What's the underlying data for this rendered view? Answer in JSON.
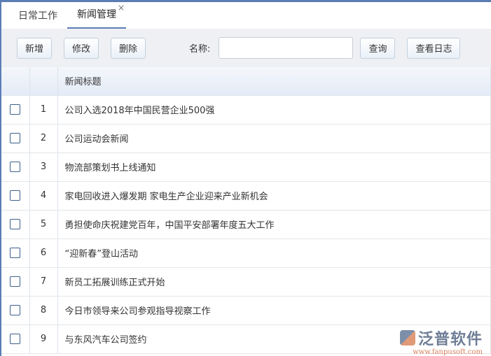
{
  "tabs": [
    {
      "label": "日常工作"
    },
    {
      "label": "新闻管理",
      "close": "×"
    }
  ],
  "toolbar": {
    "add": "新增",
    "edit": "修改",
    "delete": "删除",
    "name_label": "名称:",
    "name_value": "",
    "query": "查询",
    "log": "查看日志"
  },
  "table": {
    "header": "新闻标题",
    "rows": [
      {
        "no": "1",
        "title": "公司入选2018年中国民营企业500强"
      },
      {
        "no": "2",
        "title": "公司运动会新闻"
      },
      {
        "no": "3",
        "title": "物流部策划书上线通知"
      },
      {
        "no": "4",
        "title": "家电回收进入爆发期 家电生产企业迎来产业新机会"
      },
      {
        "no": "5",
        "title": "勇担使命庆祝建党百年，中国平安部署年度五大工作"
      },
      {
        "no": "6",
        "title": "“迎新春”登山活动"
      },
      {
        "no": "7",
        "title": "新员工拓展训练正式开始"
      },
      {
        "no": "8",
        "title": "今日市领导来公司参观指导视察工作"
      },
      {
        "no": "9",
        "title": "与东风汽车公司签约"
      }
    ]
  },
  "logo": {
    "name": "泛普软件",
    "url": "www.fanpusoft.com"
  }
}
